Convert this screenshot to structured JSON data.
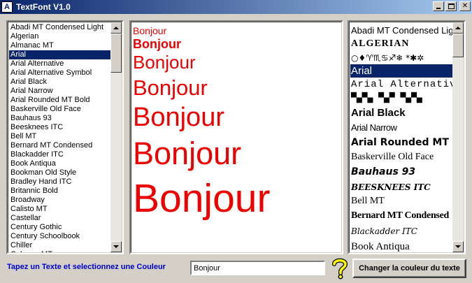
{
  "window": {
    "title": "TextFont V1.0",
    "icon_letter": "A"
  },
  "font_list": {
    "items": [
      "Abadi MT Condensed Light",
      "Algerian",
      "Almanac MT",
      "Arial",
      "Arial Alternative",
      "Arial Alternative Symbol",
      "Arial Black",
      "Arial Narrow",
      "Arial Rounded MT Bold",
      "Baskerville Old Face",
      "Bauhaus 93",
      "Beesknees ITC",
      "Bell MT",
      "Bernard MT Condensed",
      "Blackadder ITC",
      "Book Antiqua",
      "Bookman Old Style",
      "Bradley Hand ITC",
      "Britannic Bold",
      "Broadway",
      "Calisto MT",
      "Castellar",
      "Century Gothic",
      "Century Schoolbook",
      "Chiller",
      "Colonna MT"
    ],
    "selected": "Arial"
  },
  "preview": {
    "text": "Bonjour",
    "color": "#ee0000"
  },
  "sample_list": {
    "items": [
      "Abadi MT Condensed Light",
      "ALGERIAN",
      "○♦♈♏♋♐❄ *✱✲",
      "Arial",
      "Arial Alternative",
      "▀▄▀▄ ▀▄▀ ▀▄▀▄",
      "Arial Black",
      "Arial Narrow",
      "Arial Rounded MT Bold",
      "Baskerville Old Face",
      "Bauhaus 93",
      "BEESKNEES ITC",
      "Bell MT",
      "Bernard MT Condensed",
      "Blackadder ITC",
      "Book Antiqua"
    ],
    "selected": "Arial"
  },
  "bottom": {
    "prompt": "Tapez un Texte et selectionnez une Couleur",
    "input_value": "Bonjour",
    "button_label": "Changer la couleur du texte"
  }
}
